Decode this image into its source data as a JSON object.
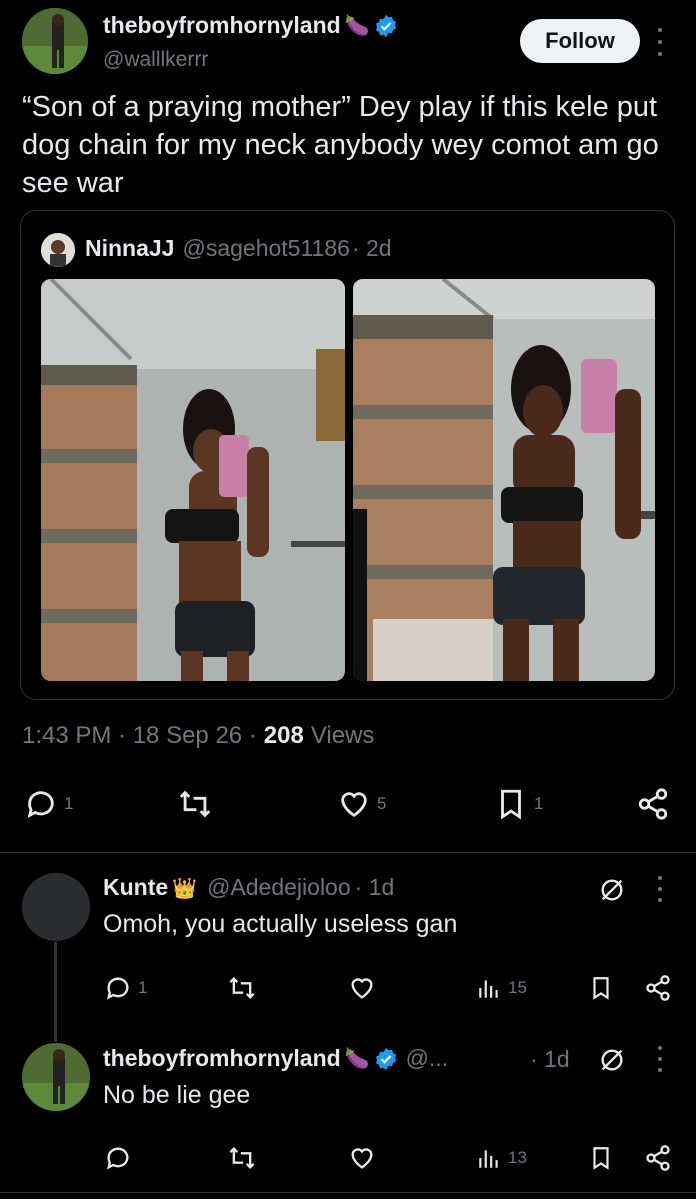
{
  "main_tweet": {
    "display_name": "theboyfromhornyland",
    "name_emoji": "🍆",
    "handle": "@walllkerrr",
    "follow_label": "Follow",
    "text": "“Son of a praying mother” Dey play if this kele put dog chain for my neck anybody wey comot am go see war",
    "timestamp": "1:43 PM · 18 Sep 26 ·",
    "views_count": "208",
    "views_label": "Views",
    "replies": "1",
    "retweets": "",
    "likes": "5",
    "bookmarks": "1"
  },
  "quoted_tweet": {
    "display_name": "NinnaJJ",
    "handle": "@sagehot51186",
    "time": "· 2d"
  },
  "reply_1": {
    "display_name": "Kunte",
    "name_emoji": "👑",
    "handle": "@Adedejioloo",
    "time": "· 1d",
    "text": "Omoh, you actually useless gan",
    "replies": "1",
    "views": "15"
  },
  "reply_2": {
    "display_name": "theboyfromhornyland",
    "name_emoji": "🍆",
    "handle": "@...",
    "time": "· 1d",
    "text": "No be lie gee",
    "views": "13"
  },
  "colors": {
    "background": "#000000",
    "verified": "#1d9bf0",
    "text": "#e7e9ea",
    "muted": "#71767b",
    "border": "#2f3336"
  },
  "icons": [
    "verified-badge-icon",
    "more-icon",
    "reply-icon",
    "retweet-icon",
    "like-icon",
    "bookmark-icon",
    "share-icon",
    "views-icon",
    "grok-icon"
  ]
}
